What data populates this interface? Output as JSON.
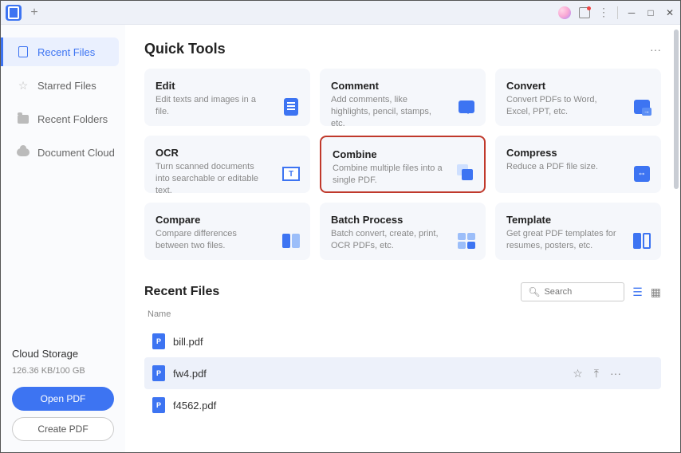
{
  "titlebar": {
    "plus": "+",
    "minimize": "─",
    "maximize": "□",
    "close": "✕"
  },
  "sidebar": {
    "items": [
      {
        "label": "Recent Files"
      },
      {
        "label": "Starred Files"
      },
      {
        "label": "Recent Folders"
      },
      {
        "label": "Document Cloud"
      }
    ],
    "footer": {
      "title": "Cloud Storage",
      "usage": "126.36 KB/100 GB",
      "open_label": "Open PDF",
      "create_label": "Create PDF"
    }
  },
  "main": {
    "quick_tools_title": "Quick Tools",
    "more": "···",
    "tools": [
      {
        "title": "Edit",
        "desc": "Edit texts and images in a file."
      },
      {
        "title": "Comment",
        "desc": "Add comments, like highlights, pencil, stamps, etc."
      },
      {
        "title": "Convert",
        "desc": "Convert PDFs to Word, Excel, PPT, etc."
      },
      {
        "title": "OCR",
        "desc": "Turn scanned documents into searchable or editable text."
      },
      {
        "title": "Combine",
        "desc": "Combine multiple files into a single PDF."
      },
      {
        "title": "Compress",
        "desc": "Reduce a PDF file size."
      },
      {
        "title": "Compare",
        "desc": "Compare differences between two files."
      },
      {
        "title": "Batch Process",
        "desc": "Batch convert, create, print, OCR PDFs, etc."
      },
      {
        "title": "Template",
        "desc": "Get great PDF templates for resumes, posters, etc."
      }
    ],
    "recent_title": "Recent Files",
    "search_placeholder": "Search",
    "col_name": "Name",
    "files": [
      {
        "name": "bill.pdf"
      },
      {
        "name": "fw4.pdf"
      },
      {
        "name": "f4562.pdf"
      }
    ],
    "row_actions": {
      "star": "☆",
      "pin": "⤒",
      "more": "···"
    }
  }
}
